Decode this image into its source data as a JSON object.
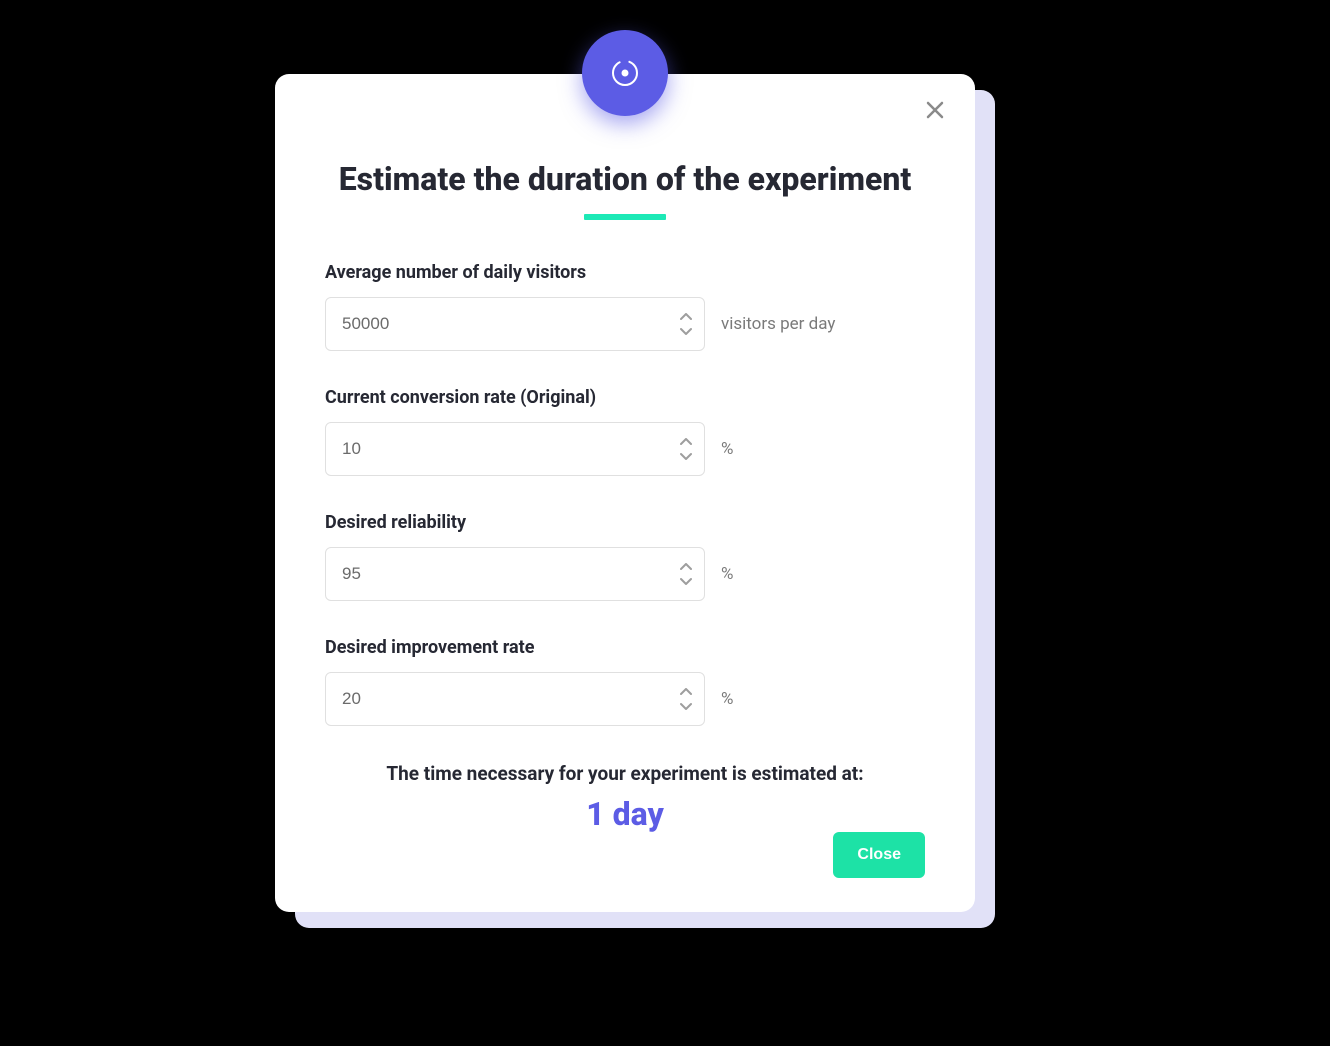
{
  "modal": {
    "title": "Estimate the duration of the experiment",
    "fields": {
      "visitors": {
        "label": "Average number of daily visitors",
        "value": "50000",
        "unit": "visitors per day"
      },
      "conversion": {
        "label": "Current conversion rate (Original)",
        "value": "10",
        "unit": "%"
      },
      "reliability": {
        "label": "Desired reliability",
        "value": "95",
        "unit": "%"
      },
      "improvement": {
        "label": "Desired improvement rate",
        "value": "20",
        "unit": "%"
      }
    },
    "result": {
      "label": "The time necessary for your experiment is estimated at:",
      "value": "1 day"
    },
    "close_button": "Close"
  },
  "colors": {
    "accent_purple": "#5C5CE5",
    "accent_teal": "#1DE2A6",
    "underline_teal": "#1DE9B6"
  }
}
